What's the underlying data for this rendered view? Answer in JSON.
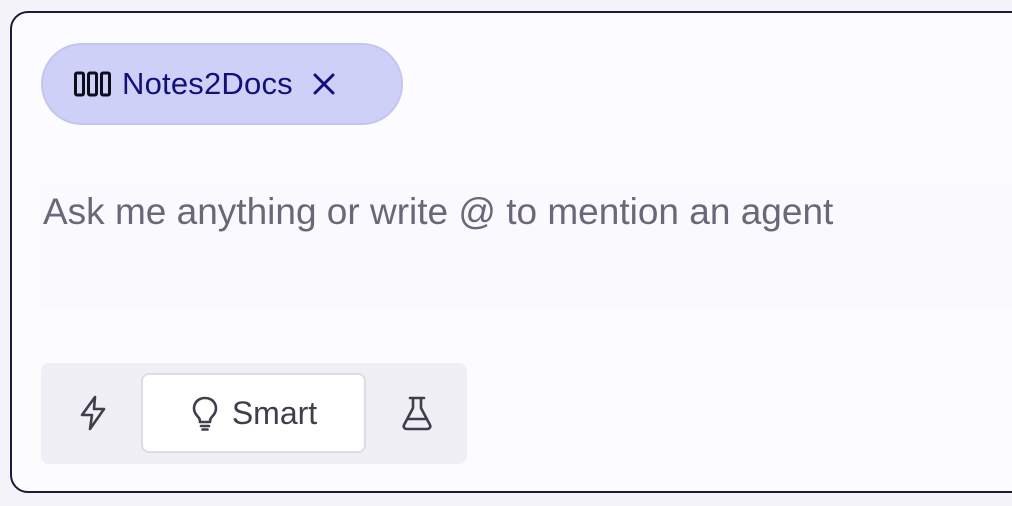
{
  "agent_chip": {
    "label": "Notes2Docs",
    "icon": "columns-icon",
    "close_icon": "close-icon"
  },
  "prompt": {
    "placeholder": "Ask me anything or write @ to mention an agent",
    "value": ""
  },
  "modes": {
    "fast": {
      "icon": "lightning-icon"
    },
    "smart": {
      "label": "Smart",
      "icon": "lightbulb-icon",
      "selected": true
    },
    "experimental": {
      "icon": "flask-icon"
    }
  },
  "colors": {
    "chip_background": "#cfd0f8",
    "chip_text": "#12117a",
    "border": "#1c1b3a"
  }
}
